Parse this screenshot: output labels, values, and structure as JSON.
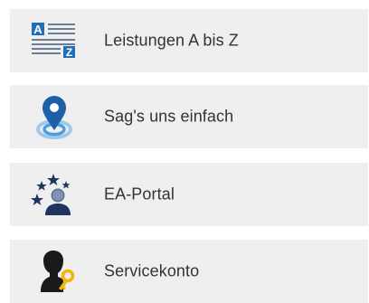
{
  "menu": {
    "items": [
      {
        "label": "Leistungen A bis Z",
        "icon": "a-to-z-list-icon"
      },
      {
        "label": "Sag's uns einfach",
        "icon": "location-pin-icon"
      },
      {
        "label": "EA-Portal",
        "icon": "stars-user-icon"
      },
      {
        "label": "Servicekonto",
        "icon": "user-key-icon"
      }
    ]
  },
  "icons": {
    "az_letter_a": "A",
    "az_letter_z": "Z"
  },
  "colors": {
    "tile_background": "#efefef",
    "label_text": "#333333",
    "accent_blue": "#1e6fb8",
    "navy": "#1f3560",
    "key_yellow": "#f2b705"
  }
}
